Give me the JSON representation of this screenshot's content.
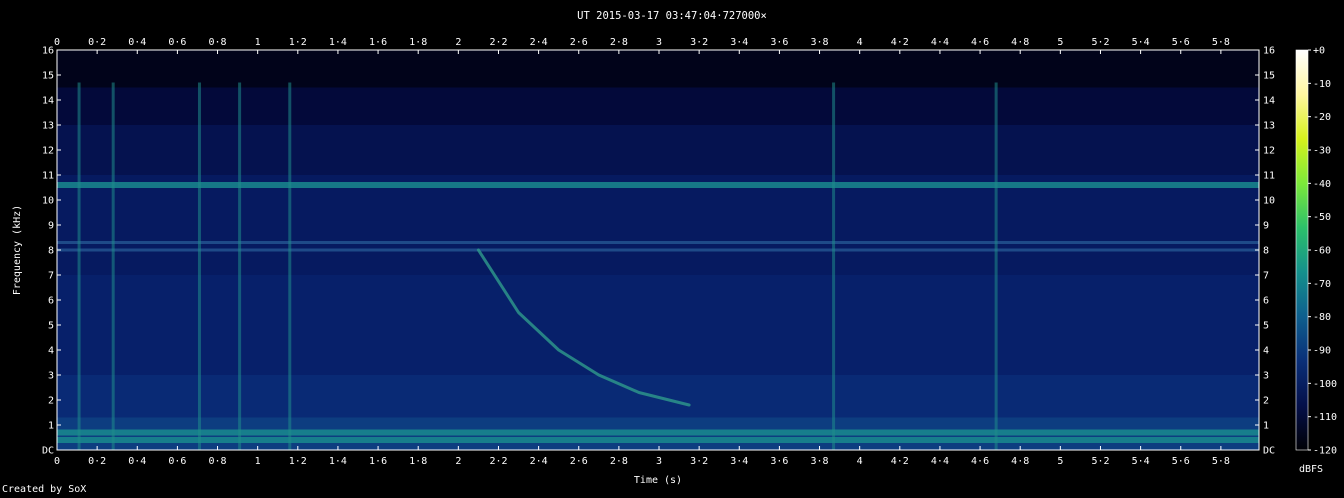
{
  "chart_data": {
    "type": "heatmap",
    "title": "UT 2015-03-17 03:47:04·727000×",
    "xlabel": "Time (s)",
    "ylabel": "Frequency (kHz)",
    "xlim": [
      0,
      5.99
    ],
    "ylim": [
      0,
      16
    ],
    "x_ticks": [
      "0",
      "0·2",
      "0·4",
      "0·6",
      "0·8",
      "1",
      "1·2",
      "1·4",
      "1·6",
      "1·8",
      "2",
      "2·2",
      "2·4",
      "2·6",
      "2·8",
      "3",
      "3·2",
      "3·4",
      "3·6",
      "3·8",
      "4",
      "4·2",
      "4·4",
      "4·6",
      "4·8",
      "5",
      "5·2",
      "5·4",
      "5·6",
      "5·8"
    ],
    "y_ticks": [
      "DC",
      "1",
      "2",
      "3",
      "4",
      "5",
      "6",
      "7",
      "8",
      "9",
      "10",
      "11",
      "12",
      "13",
      "14",
      "15",
      "16"
    ],
    "colorbar": {
      "label": "dBFS",
      "ticks": [
        "+0",
        "-10",
        "-20",
        "-30",
        "-40",
        "-50",
        "-60",
        "-70",
        "-80",
        "-90",
        "-100",
        "-110",
        "-120"
      ],
      "range": [
        -120,
        0
      ],
      "colors": [
        "#000005",
        "#04104a",
        "#0a2f78",
        "#0e5f8e",
        "#14908c",
        "#2cc06a",
        "#7ce83a",
        "#d6f21c",
        "#fff6a0",
        "#ffffff"
      ]
    },
    "features": {
      "horizontal_lines_khz": [
        10.6,
        8.3,
        8.0,
        0.7,
        0.4
      ],
      "impulses_s": [
        0.11,
        0.28,
        0.71,
        0.91,
        1.16,
        3.87,
        4.68
      ],
      "whistler_sweep": {
        "t": [
          2.1,
          2.3,
          2.5,
          2.7,
          2.9,
          3.15
        ],
        "f_khz": [
          8.0,
          5.5,
          4.0,
          3.0,
          2.3,
          1.8
        ]
      },
      "grid": false
    }
  },
  "credit": "Created by SoX"
}
